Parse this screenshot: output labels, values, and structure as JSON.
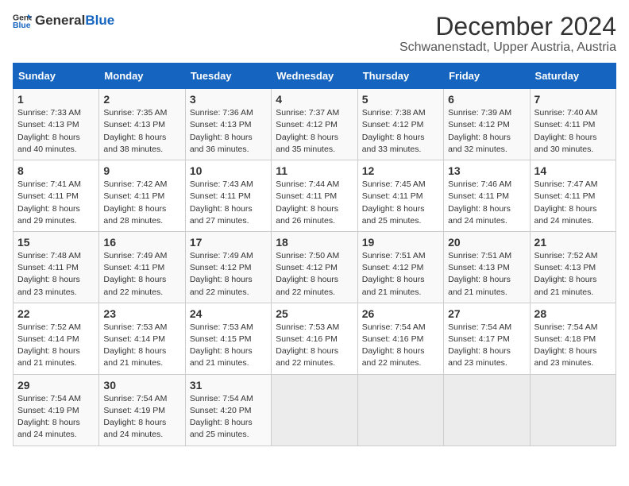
{
  "logo": {
    "general": "General",
    "blue": "Blue"
  },
  "title": "December 2024",
  "subtitle": "Schwanenstadt, Upper Austria, Austria",
  "days_header": [
    "Sunday",
    "Monday",
    "Tuesday",
    "Wednesday",
    "Thursday",
    "Friday",
    "Saturday"
  ],
  "weeks": [
    [
      {
        "day": "1",
        "sunrise": "Sunrise: 7:33 AM",
        "sunset": "Sunset: 4:13 PM",
        "daylight": "Daylight: 8 hours and 40 minutes."
      },
      {
        "day": "2",
        "sunrise": "Sunrise: 7:35 AM",
        "sunset": "Sunset: 4:13 PM",
        "daylight": "Daylight: 8 hours and 38 minutes."
      },
      {
        "day": "3",
        "sunrise": "Sunrise: 7:36 AM",
        "sunset": "Sunset: 4:13 PM",
        "daylight": "Daylight: 8 hours and 36 minutes."
      },
      {
        "day": "4",
        "sunrise": "Sunrise: 7:37 AM",
        "sunset": "Sunset: 4:12 PM",
        "daylight": "Daylight: 8 hours and 35 minutes."
      },
      {
        "day": "5",
        "sunrise": "Sunrise: 7:38 AM",
        "sunset": "Sunset: 4:12 PM",
        "daylight": "Daylight: 8 hours and 33 minutes."
      },
      {
        "day": "6",
        "sunrise": "Sunrise: 7:39 AM",
        "sunset": "Sunset: 4:12 PM",
        "daylight": "Daylight: 8 hours and 32 minutes."
      },
      {
        "day": "7",
        "sunrise": "Sunrise: 7:40 AM",
        "sunset": "Sunset: 4:11 PM",
        "daylight": "Daylight: 8 hours and 30 minutes."
      }
    ],
    [
      {
        "day": "8",
        "sunrise": "Sunrise: 7:41 AM",
        "sunset": "Sunset: 4:11 PM",
        "daylight": "Daylight: 8 hours and 29 minutes."
      },
      {
        "day": "9",
        "sunrise": "Sunrise: 7:42 AM",
        "sunset": "Sunset: 4:11 PM",
        "daylight": "Daylight: 8 hours and 28 minutes."
      },
      {
        "day": "10",
        "sunrise": "Sunrise: 7:43 AM",
        "sunset": "Sunset: 4:11 PM",
        "daylight": "Daylight: 8 hours and 27 minutes."
      },
      {
        "day": "11",
        "sunrise": "Sunrise: 7:44 AM",
        "sunset": "Sunset: 4:11 PM",
        "daylight": "Daylight: 8 hours and 26 minutes."
      },
      {
        "day": "12",
        "sunrise": "Sunrise: 7:45 AM",
        "sunset": "Sunset: 4:11 PM",
        "daylight": "Daylight: 8 hours and 25 minutes."
      },
      {
        "day": "13",
        "sunrise": "Sunrise: 7:46 AM",
        "sunset": "Sunset: 4:11 PM",
        "daylight": "Daylight: 8 hours and 24 minutes."
      },
      {
        "day": "14",
        "sunrise": "Sunrise: 7:47 AM",
        "sunset": "Sunset: 4:11 PM",
        "daylight": "Daylight: 8 hours and 24 minutes."
      }
    ],
    [
      {
        "day": "15",
        "sunrise": "Sunrise: 7:48 AM",
        "sunset": "Sunset: 4:11 PM",
        "daylight": "Daylight: 8 hours and 23 minutes."
      },
      {
        "day": "16",
        "sunrise": "Sunrise: 7:49 AM",
        "sunset": "Sunset: 4:11 PM",
        "daylight": "Daylight: 8 hours and 22 minutes."
      },
      {
        "day": "17",
        "sunrise": "Sunrise: 7:49 AM",
        "sunset": "Sunset: 4:12 PM",
        "daylight": "Daylight: 8 hours and 22 minutes."
      },
      {
        "day": "18",
        "sunrise": "Sunrise: 7:50 AM",
        "sunset": "Sunset: 4:12 PM",
        "daylight": "Daylight: 8 hours and 22 minutes."
      },
      {
        "day": "19",
        "sunrise": "Sunrise: 7:51 AM",
        "sunset": "Sunset: 4:12 PM",
        "daylight": "Daylight: 8 hours and 21 minutes."
      },
      {
        "day": "20",
        "sunrise": "Sunrise: 7:51 AM",
        "sunset": "Sunset: 4:13 PM",
        "daylight": "Daylight: 8 hours and 21 minutes."
      },
      {
        "day": "21",
        "sunrise": "Sunrise: 7:52 AM",
        "sunset": "Sunset: 4:13 PM",
        "daylight": "Daylight: 8 hours and 21 minutes."
      }
    ],
    [
      {
        "day": "22",
        "sunrise": "Sunrise: 7:52 AM",
        "sunset": "Sunset: 4:14 PM",
        "daylight": "Daylight: 8 hours and 21 minutes."
      },
      {
        "day": "23",
        "sunrise": "Sunrise: 7:53 AM",
        "sunset": "Sunset: 4:14 PM",
        "daylight": "Daylight: 8 hours and 21 minutes."
      },
      {
        "day": "24",
        "sunrise": "Sunrise: 7:53 AM",
        "sunset": "Sunset: 4:15 PM",
        "daylight": "Daylight: 8 hours and 21 minutes."
      },
      {
        "day": "25",
        "sunrise": "Sunrise: 7:53 AM",
        "sunset": "Sunset: 4:16 PM",
        "daylight": "Daylight: 8 hours and 22 minutes."
      },
      {
        "day": "26",
        "sunrise": "Sunrise: 7:54 AM",
        "sunset": "Sunset: 4:16 PM",
        "daylight": "Daylight: 8 hours and 22 minutes."
      },
      {
        "day": "27",
        "sunrise": "Sunrise: 7:54 AM",
        "sunset": "Sunset: 4:17 PM",
        "daylight": "Daylight: 8 hours and 23 minutes."
      },
      {
        "day": "28",
        "sunrise": "Sunrise: 7:54 AM",
        "sunset": "Sunset: 4:18 PM",
        "daylight": "Daylight: 8 hours and 23 minutes."
      }
    ],
    [
      {
        "day": "29",
        "sunrise": "Sunrise: 7:54 AM",
        "sunset": "Sunset: 4:19 PM",
        "daylight": "Daylight: 8 hours and 24 minutes."
      },
      {
        "day": "30",
        "sunrise": "Sunrise: 7:54 AM",
        "sunset": "Sunset: 4:19 PM",
        "daylight": "Daylight: 8 hours and 24 minutes."
      },
      {
        "day": "31",
        "sunrise": "Sunrise: 7:54 AM",
        "sunset": "Sunset: 4:20 PM",
        "daylight": "Daylight: 8 hours and 25 minutes."
      },
      null,
      null,
      null,
      null
    ]
  ]
}
